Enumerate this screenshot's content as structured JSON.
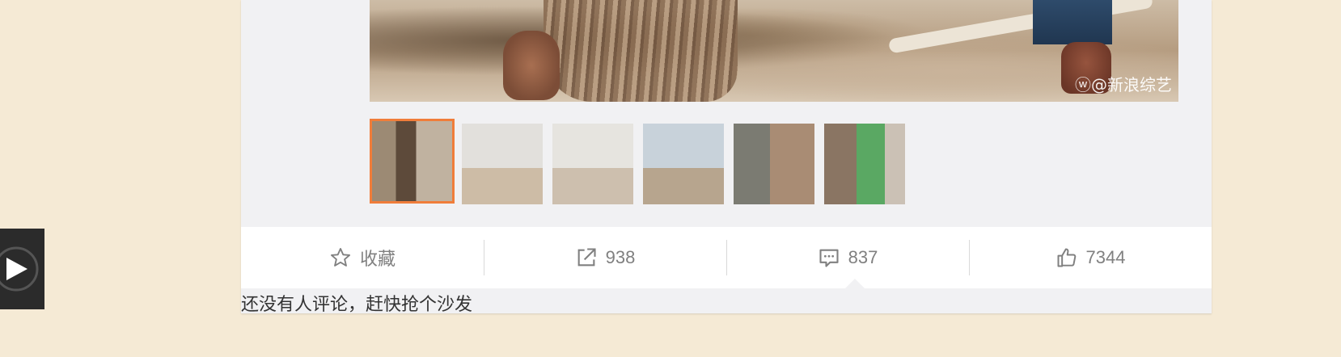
{
  "photo": {
    "watermark": "@新浪综艺"
  },
  "thumbnails": [
    {
      "name": "thumb-1",
      "active": true
    },
    {
      "name": "thumb-2",
      "active": false
    },
    {
      "name": "thumb-3",
      "active": false
    },
    {
      "name": "thumb-4",
      "active": false
    },
    {
      "name": "thumb-5",
      "active": false
    },
    {
      "name": "thumb-6",
      "active": false
    }
  ],
  "actions": {
    "favorite": {
      "label": "收藏",
      "icon": "star-icon"
    },
    "repost": {
      "label": "938",
      "icon": "share-icon"
    },
    "comment": {
      "label": "837",
      "icon": "comment-icon"
    },
    "like": {
      "label": "7344",
      "icon": "thumbs-up-icon"
    }
  },
  "comments": {
    "empty_text": "还没有人评论，赶快抢个沙发"
  },
  "colors": {
    "page_bg": "#f5ead5",
    "active_thumb_border": "#f07d3a",
    "action_text": "#808080"
  }
}
